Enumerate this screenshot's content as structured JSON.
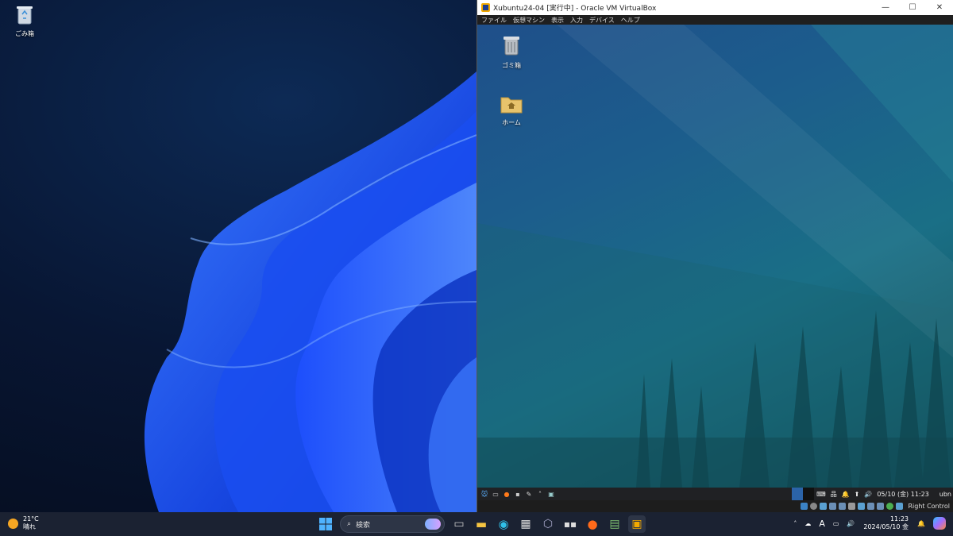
{
  "windows_desktop": {
    "icons": [
      {
        "label": "ごみ箱",
        "icon": "recycle-bin-icon"
      }
    ]
  },
  "vbox": {
    "title": "Xubuntu24-04 [実行中] - Oracle VM VirtualBox",
    "menu": [
      "ファイル",
      "仮想マシン",
      "表示",
      "入力",
      "デバイス",
      "ヘルプ"
    ],
    "window_buttons": {
      "minimize": "—",
      "maximize": "☐",
      "close": "✕"
    },
    "host_key": "Right Control"
  },
  "xubuntu": {
    "icons": [
      {
        "label": "ゴミ箱",
        "icon": "trash-icon"
      },
      {
        "label": "ホーム",
        "icon": "home-folder-icon"
      }
    ],
    "panel": {
      "clock": "05/10 (金) 11:23",
      "user": "ubn"
    }
  },
  "taskbar": {
    "weather": {
      "temp": "21°C",
      "condition": "晴れ"
    },
    "search_placeholder": "検索",
    "clock": {
      "time": "11:23",
      "date": "2024/05/10 金"
    },
    "ime": "A"
  },
  "colors": {
    "taskbar_bg": "#1b2232",
    "vm_bg": "#1c5d8c",
    "accent": "#2f6cff"
  }
}
